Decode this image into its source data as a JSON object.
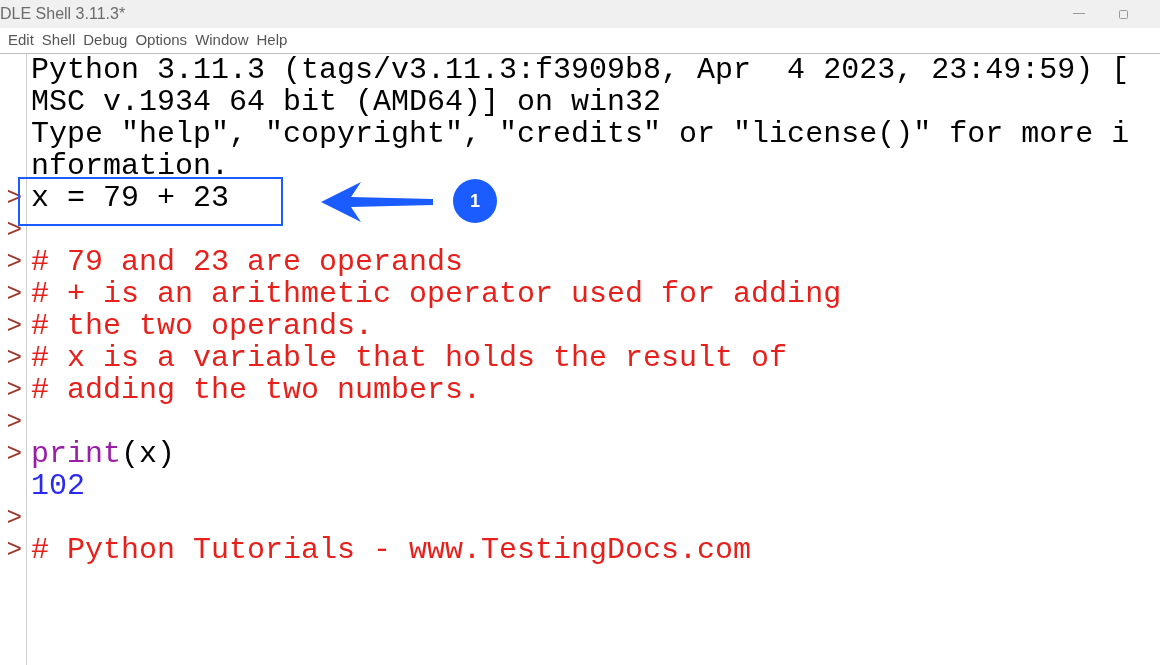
{
  "window": {
    "title": "DLE Shell 3.11.3*"
  },
  "menu": [
    "Edit",
    "Shell",
    "Debug",
    "Options",
    "Window",
    "Help"
  ],
  "prompt_symbol": ">",
  "lines": [
    {
      "prompt": false,
      "segments": [
        {
          "kind": "output",
          "text": "Python 3.11.3 (tags/v3.11.3:f3909b8, Apr  4 2023, 23:49:59) ["
        }
      ]
    },
    {
      "prompt": false,
      "segments": [
        {
          "kind": "output",
          "text": "MSC v.1934 64 bit (AMD64)] on win32"
        }
      ]
    },
    {
      "prompt": false,
      "segments": [
        {
          "kind": "output",
          "text": "Type \"help\", \"copyright\", \"credits\" or \"license()\" for more i"
        }
      ]
    },
    {
      "prompt": false,
      "segments": [
        {
          "kind": "output",
          "text": "nformation."
        }
      ]
    },
    {
      "prompt": true,
      "segments": [
        {
          "kind": "code",
          "text": "x = 79 + 23"
        }
      ]
    },
    {
      "prompt": true
    },
    {
      "prompt": true,
      "segments": [
        {
          "kind": "comment",
          "text": "# 79 and 23 are operands"
        }
      ]
    },
    {
      "prompt": true,
      "segments": [
        {
          "kind": "comment",
          "text": "# + is an arithmetic operator used for adding"
        }
      ]
    },
    {
      "prompt": true,
      "segments": [
        {
          "kind": "comment",
          "text": "# the two operands."
        }
      ]
    },
    {
      "prompt": true,
      "segments": [
        {
          "kind": "comment",
          "text": "# x is a variable that holds the result of"
        }
      ]
    },
    {
      "prompt": true,
      "segments": [
        {
          "kind": "comment",
          "text": "# adding the two numbers."
        }
      ]
    },
    {
      "prompt": true
    },
    {
      "prompt": true,
      "segments": [
        {
          "kind": "builtin",
          "text": "print"
        },
        {
          "kind": "code",
          "text": "(x)"
        }
      ]
    },
    {
      "prompt": false,
      "segments": [
        {
          "kind": "result",
          "text": "102"
        }
      ]
    },
    {
      "prompt": true
    },
    {
      "prompt": true,
      "segments": [
        {
          "kind": "comment",
          "text": "# Python Tutorials - www.TestingDocs.com"
        }
      ]
    }
  ],
  "callout": {
    "number": "1"
  }
}
